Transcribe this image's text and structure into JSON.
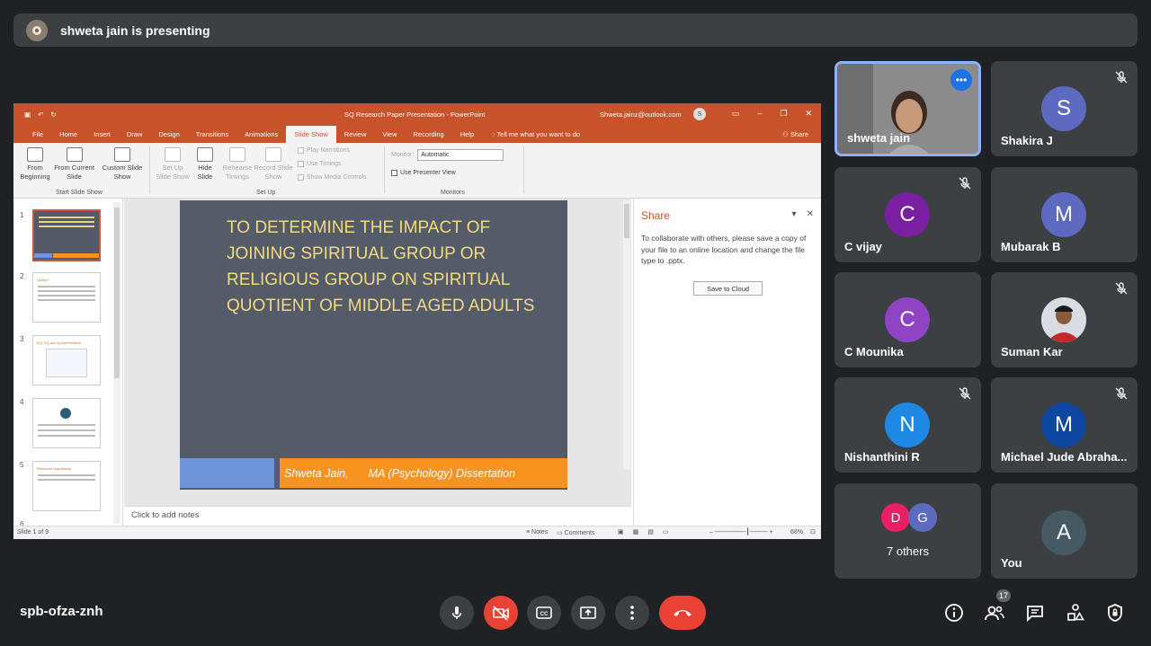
{
  "presenting_bar": {
    "text": "shweta jain is presenting"
  },
  "powerpoint": {
    "title_bar": {
      "document": "SQ Research Paper Presentation - PowerPoint",
      "account": "Shweta.jainz@outlook.com",
      "account_initial": "S"
    },
    "tabs": [
      "File",
      "Home",
      "Insert",
      "Draw",
      "Design",
      "Transitions",
      "Animations",
      "Slide Show",
      "Review",
      "View",
      "Recording",
      "Help"
    ],
    "active_tab": "Slide Show",
    "tell_me": "Tell me what you want to do",
    "share_label": "Share",
    "ribbon": {
      "from_beginning": "From Beginning",
      "from_current": "From Current Slide",
      "custom_show": "Custom Slide Show",
      "start_group": "Start Slide Show",
      "set_up_show": "Set Up Slide Show",
      "hide_slide": "Hide Slide",
      "rehearse": "Rehearse Timings",
      "record": "Record Slide Show",
      "play_narrations": "Play Narrations",
      "use_timings": "Use Timings",
      "show_media": "Show Media Controls",
      "setup_group": "Set Up",
      "monitor_label": "Monitor:",
      "monitor_value": "Automatic",
      "presenter_view": "Use Presenter View",
      "monitors_group": "Monitors"
    },
    "thumbnails": [
      {
        "num": "1"
      },
      {
        "num": "2",
        "title": "Outline"
      },
      {
        "num": "3",
        "title": "EQ, SQ and IQ interrelation"
      },
      {
        "num": "4"
      },
      {
        "num": "5",
        "title": "Research Hypothesis"
      },
      {
        "num": "6"
      }
    ],
    "slide": {
      "heading": "To determine the impact of joining spiritual group or religious group on spiritual quotient of middle aged adults",
      "author": "Shweta Jain,",
      "subtitle": "MA (Psychology) Dissertation"
    },
    "notes_placeholder": "Click to add notes",
    "share_pane": {
      "title": "Share",
      "text": "To collaborate with others, please save a copy of your file to an online location and change the file type to .pptx.",
      "button": "Save to Cloud"
    },
    "status": {
      "slide_of": "Slide 1 of 9",
      "notes": "Notes",
      "comments": "Comments",
      "zoom": "68%"
    }
  },
  "participants": [
    {
      "name": "shweta jain",
      "video": true,
      "muted": false
    },
    {
      "name": "Shakira J",
      "initial": "S",
      "color": "#5c6bc0",
      "muted": true
    },
    {
      "name": "C vijay",
      "initial": "C",
      "color": "#7b1fa2",
      "muted": true
    },
    {
      "name": "Mubarak B",
      "initial": "M",
      "color": "#5c6bc0",
      "muted": false
    },
    {
      "name": "C Mounika",
      "initial": "C",
      "color": "#8e44c4",
      "muted": false
    },
    {
      "name": "Suman Kar",
      "photo": true,
      "muted": true
    },
    {
      "name": "Nishanthini R",
      "initial": "N",
      "color": "#1e88e5",
      "muted": true
    },
    {
      "name": "Michael Jude Abraha...",
      "initial": "M",
      "color": "#0d47a1",
      "muted": true
    },
    {
      "others": "7 others",
      "initials": [
        "D",
        "G"
      ],
      "colors": [
        "#e91e63",
        "#5c6bc0"
      ]
    },
    {
      "name": "You",
      "initial": "A",
      "color": "#455a64",
      "muted": false
    }
  ],
  "meeting_code": "spb-ofza-znh",
  "participant_count": "17"
}
